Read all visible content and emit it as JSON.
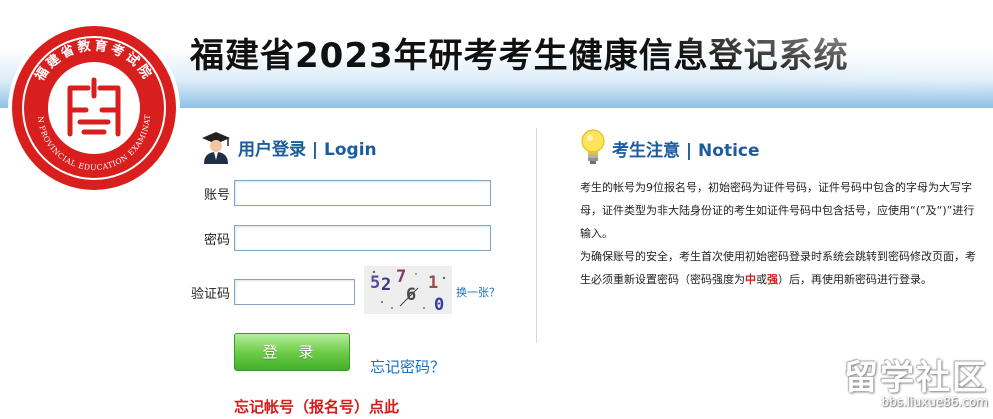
{
  "header": {
    "title": "福建省2023年研考考生健康信息登记系统"
  },
  "logo": {
    "outer_text_top": "福建省教育考试院",
    "outer_text_bottom": "FUJIAN PROVINCIAL EDUCATION EXAMINATIONS",
    "icon": "fujian-education-exam-seal"
  },
  "login": {
    "heading": "用户登录 | Login",
    "account_label": "账号",
    "account_value": "",
    "password_label": "密码",
    "password_value": "",
    "captcha_label": "验证码",
    "captcha_value": "",
    "captcha_chars": "52761 0",
    "refresh_link": "换一张？",
    "login_button": "登 录",
    "forgot_password": "忘记密码？",
    "forgot_account": "忘记帐号（报名号）点此"
  },
  "notice": {
    "heading": "考生注意 | Notice",
    "para1": "考生的帐号为9位报名号，初始密码为证件号码，证件号码中包含的字母为大写字母，证件类型为非大陆身份证的考生如证件号码中包含括号，应使用“(”及“)”进行输入。",
    "para2_a": "为确保账号的安全，考生首次使用初始密码登录时系统会跳转到密码修改页面，考生必须重新设置密码（密码强度为",
    "para2_mid": "中",
    "para2_or": "或",
    "para2_strong": "强",
    "para2_b": "）后，再使用新密码进行登录。"
  },
  "watermark": {
    "main": "留学社区",
    "url": "bbs.liuxue86.com"
  },
  "colors": {
    "accent_blue": "#1a5c9e",
    "link_blue": "#1a6fc0",
    "alert_red": "#d41c1c",
    "button_green": "#43b02a"
  }
}
